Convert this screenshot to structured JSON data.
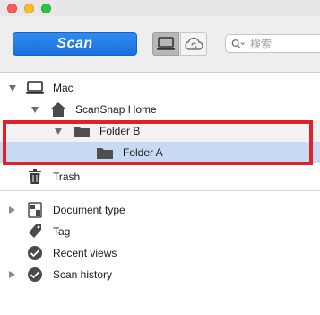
{
  "window": {
    "controls": [
      "close",
      "minimize",
      "zoom"
    ]
  },
  "toolbar": {
    "scan_label": "Scan",
    "mode_local_icon": "computer-icon",
    "mode_cloud_icon": "cloud-sync-icon",
    "search": {
      "placeholder": "検索",
      "value": ""
    }
  },
  "tree": {
    "mac": {
      "label": "Mac",
      "expanded": true,
      "icon": "computer-icon"
    },
    "scansnap_home": {
      "label": "ScanSnap Home",
      "expanded": true,
      "icon": "home-icon"
    },
    "folder_b": {
      "label": "Folder B",
      "expanded": true,
      "icon": "folder-icon"
    },
    "folder_a": {
      "label": "Folder A",
      "selected": true,
      "icon": "folder-icon"
    },
    "trash": {
      "label": "Trash",
      "icon": "trash-icon"
    }
  },
  "filters": [
    {
      "label": "Document type",
      "icon": "document-type-icon",
      "expandable": true
    },
    {
      "label": "Tag",
      "icon": "tag-icon",
      "expandable": false
    },
    {
      "label": "Recent views",
      "icon": "recent-views-icon",
      "expandable": false
    },
    {
      "label": "Scan history",
      "icon": "scan-history-icon",
      "expandable": true
    }
  ],
  "colors": {
    "scan_button": "#1a6fdb",
    "selection": "#c8daf1",
    "highlight_box": "#e0202a"
  }
}
